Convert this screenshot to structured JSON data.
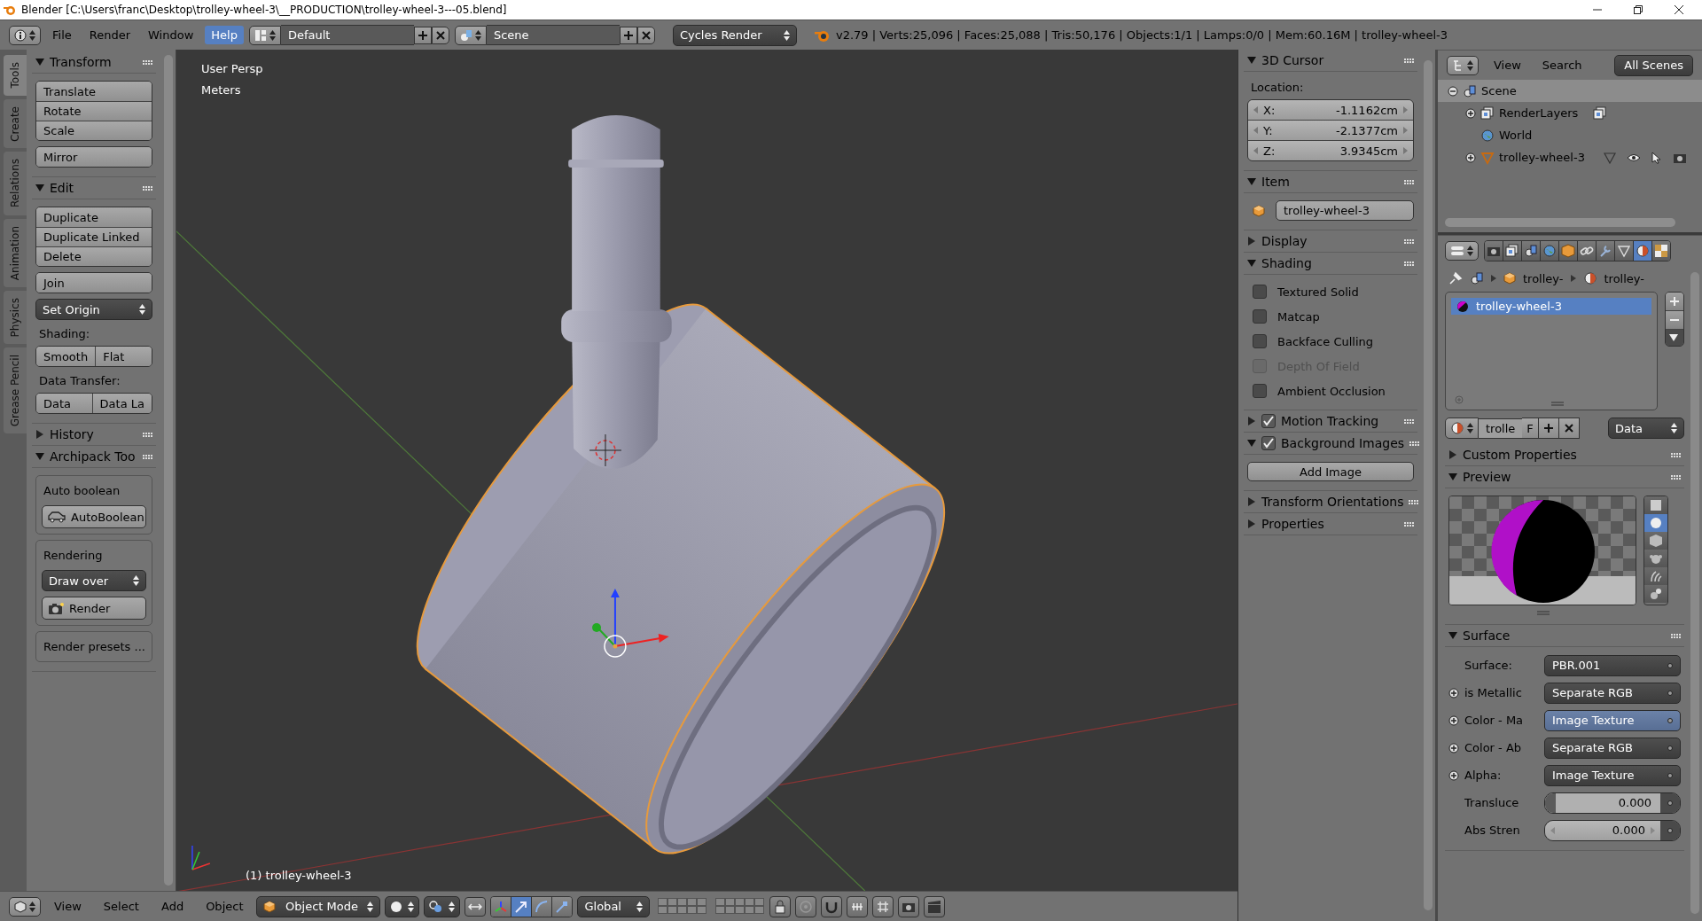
{
  "window": {
    "title": "Blender [C:\\Users\\franc\\Desktop\\trolley-wheel-3\\__PRODUCTION\\trolley-wheel-3---05.blend]"
  },
  "info_header": {
    "menus": [
      {
        "label": "File",
        "selected": false
      },
      {
        "label": "Render",
        "selected": false
      },
      {
        "label": "Window",
        "selected": false
      },
      {
        "label": "Help",
        "selected": true
      }
    ],
    "screen_layout": "Default",
    "scene": "Scene",
    "render_engine": "Cycles Render",
    "stats": "v2.79 | Verts:25,096 | Faces:25,088 | Tris:50,176 | Objects:1/1 | Lamps:0/0 | Mem:60.16M | trolley-wheel-3"
  },
  "tool_tabs": [
    {
      "label": "Tools",
      "selected": true
    },
    {
      "label": "Create",
      "selected": false
    },
    {
      "label": "Relations",
      "selected": false
    },
    {
      "label": "Animation",
      "selected": false
    },
    {
      "label": "Physics",
      "selected": false
    },
    {
      "label": "Grease Pencil",
      "selected": false
    }
  ],
  "tool_shelf": {
    "panels": [
      {
        "title": "Transform",
        "expanded": true,
        "items": [
          {
            "kind": "buttons",
            "labels": [
              "Translate",
              "Rotate",
              "Scale"
            ]
          },
          {
            "kind": "buttons",
            "labels": [
              "Mirror"
            ]
          }
        ]
      },
      {
        "title": "Edit",
        "expanded": true,
        "items": [
          {
            "kind": "buttons",
            "labels": [
              "Duplicate",
              "Duplicate Linked",
              "Delete"
            ]
          },
          {
            "kind": "buttons",
            "labels": [
              "Join"
            ]
          },
          {
            "kind": "dropdown",
            "label": "Set Origin"
          },
          {
            "kind": "label",
            "label": "Shading:"
          },
          {
            "kind": "row",
            "labels": [
              "Smooth",
              "Flat"
            ]
          },
          {
            "kind": "label",
            "label": "Data Transfer:"
          },
          {
            "kind": "row",
            "labels": [
              "Data",
              "Data La"
            ]
          }
        ]
      },
      {
        "title": "History",
        "expanded": false
      },
      {
        "title": "Archipack Too",
        "expanded": true,
        "items": [
          {
            "kind": "box",
            "title": "Auto boolean",
            "items": [
              {
                "kind": "car_button",
                "label": "AutoBoolean"
              }
            ]
          },
          {
            "kind": "box",
            "title": "Rendering",
            "items": [
              {
                "kind": "dropdown",
                "label": "Draw over"
              },
              {
                "kind": "camera_button",
                "label": "Render"
              }
            ]
          },
          {
            "kind": "box",
            "title": "Render presets ..."
          }
        ]
      }
    ]
  },
  "viewport": {
    "view_name": "User Persp",
    "units": "Meters",
    "object_label": "(1) trolley-wheel-3"
  },
  "view3d_header": {
    "menus": [
      "View",
      "Select",
      "Add",
      "Object"
    ],
    "mode": "Object Mode",
    "orientation": "Global",
    "manipulators": [
      {
        "selected": false
      },
      {
        "selected": true
      },
      {
        "selected": false
      },
      {
        "selected": false
      }
    ]
  },
  "sidebar": {
    "sections": [
      {
        "kind": "cursor",
        "title": "3D Cursor",
        "expanded": true,
        "label": "Location:",
        "fields": [
          {
            "axis": "X:",
            "value": "-1.1162cm"
          },
          {
            "axis": "Y:",
            "value": "-2.1377cm"
          },
          {
            "axis": "Z:",
            "value": "3.9345cm"
          }
        ]
      },
      {
        "kind": "item",
        "title": "Item",
        "expanded": true,
        "name": "trolley-wheel-3"
      },
      {
        "title": "Display",
        "expanded": false
      },
      {
        "kind": "checks",
        "title": "Shading",
        "expanded": true,
        "options": [
          {
            "label": "Textured Solid",
            "checked": false,
            "disabled": false
          },
          {
            "label": "Matcap",
            "checked": false,
            "disabled": false
          },
          {
            "label": "Backface Culling",
            "checked": false,
            "disabled": false
          },
          {
            "label": "Depth Of Field",
            "checked": false,
            "disabled": true
          },
          {
            "label": "Ambient Occlusion",
            "checked": false,
            "disabled": false
          }
        ]
      },
      {
        "title": "Motion Tracking",
        "expanded": false,
        "checked": true
      },
      {
        "kind": "button",
        "title": "Background Images",
        "expanded": true,
        "checked": true,
        "button": "Add Image"
      },
      {
        "title": "Transform Orientations",
        "expanded": false
      },
      {
        "title": "Properties",
        "expanded": false
      }
    ]
  },
  "outliner": {
    "menus": [
      "View",
      "Search"
    ],
    "display": "All Scenes",
    "tree": [
      {
        "kind": "scene",
        "name": "Scene",
        "expanded": true,
        "selected": true,
        "children": [
          {
            "kind": "render_layers",
            "name": "RenderLayers",
            "expanded": false,
            "selected": false
          },
          {
            "kind": "world",
            "name": "World",
            "selected": false
          },
          {
            "kind": "object",
            "name": "trolley-wheel-3",
            "expanded": false,
            "selected": false
          }
        ]
      }
    ]
  },
  "properties_editor": {
    "tabs": [
      {
        "selected": false
      },
      {
        "selected": false
      },
      {
        "selected": false
      },
      {
        "selected": false
      },
      {
        "selected": false
      },
      {
        "selected": false
      },
      {
        "selected": false
      },
      {
        "selected": false
      },
      {
        "selected": true
      },
      {
        "selected": false
      }
    ],
    "breadcrumb": [
      "trolley-",
      "trolley-"
    ],
    "slots": [
      {
        "name": "trolley-wheel-3",
        "selected": true
      }
    ],
    "datablock": {
      "name": "trolle",
      "fake_user": "F",
      "link": "Data"
    },
    "panels": [
      {
        "title": "Custom Properties",
        "expanded": false
      },
      {
        "kind": "preview",
        "title": "Preview",
        "expanded": true,
        "shapes": [
          {
            "selected": false
          },
          {
            "selected": true
          },
          {
            "selected": false
          },
          {
            "selected": false
          },
          {
            "selected": false
          },
          {
            "selected": false
          }
        ]
      },
      {
        "kind": "surface",
        "title": "Surface",
        "expanded": true,
        "rows": [
          {
            "kind": "link",
            "label": "Surface:",
            "value": "PBR.001",
            "expandable": false,
            "selected": false
          },
          {
            "kind": "link",
            "label": "is Metallic",
            "value": "Separate RGB",
            "expandable": true,
            "selected": false
          },
          {
            "kind": "link",
            "label": "Color - Ma",
            "value": "Image Texture",
            "expandable": true,
            "selected": true
          },
          {
            "kind": "link",
            "label": "Color - Ab",
            "value": "Separate RGB",
            "expandable": true,
            "selected": false
          },
          {
            "kind": "link",
            "label": "Alpha:",
            "value": "Image Texture",
            "expandable": true,
            "selected": false
          },
          {
            "kind": "slider",
            "label": "Transluce",
            "value": "0.000",
            "level": 0,
            "expandable": false,
            "selected": false
          },
          {
            "kind": "number",
            "label": "Abs Stren",
            "value": "0.000",
            "expandable": false,
            "selected": false
          }
        ]
      }
    ]
  }
}
